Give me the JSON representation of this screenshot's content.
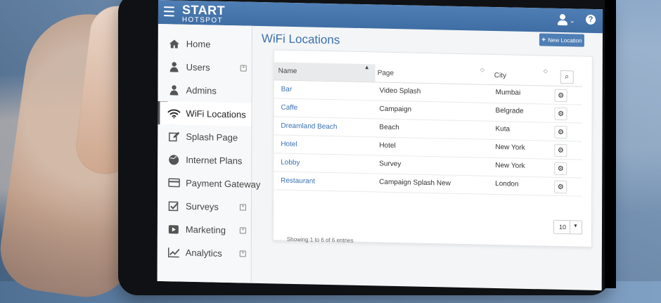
{
  "app": {
    "brand_top": "START",
    "brand_bottom": "HOTSPOT",
    "help": "?",
    "user_caret": "⌄"
  },
  "sidebar": {
    "items": [
      {
        "label": "Home",
        "icon": "home-icon"
      },
      {
        "label": "Users",
        "icon": "user-icon",
        "expandable": true
      },
      {
        "label": "Admins",
        "icon": "user-icon"
      },
      {
        "label": "WiFi Locations",
        "icon": "wifi-icon",
        "active": true
      },
      {
        "label": "Splash Page",
        "icon": "edit-icon"
      },
      {
        "label": "Internet Plans",
        "icon": "globe-icon"
      },
      {
        "label": "Payment Gateway",
        "icon": "credit-card-icon"
      },
      {
        "label": "Surveys",
        "icon": "check-square-icon",
        "expandable": true
      },
      {
        "label": "Marketing",
        "icon": "play-icon",
        "expandable": true
      },
      {
        "label": "Analytics",
        "icon": "chart-icon",
        "expandable": true
      }
    ]
  },
  "main": {
    "title": "WiFi Locations",
    "new_location_label": "New Location",
    "table": {
      "columns": [
        "Name",
        "Page",
        "City"
      ],
      "rows": [
        {
          "name": "Bar",
          "page": "Video Splash",
          "city": "Mumbai"
        },
        {
          "name": "Caffe",
          "page": "Campaign",
          "city": "Belgrade"
        },
        {
          "name": "Dreamland Beach",
          "page": "Beach",
          "city": "Kuta"
        },
        {
          "name": "Hotel",
          "page": "Hotel",
          "city": "New York"
        },
        {
          "name": "Lobby",
          "page": "Survey",
          "city": "New York"
        },
        {
          "name": "Restaurant",
          "page": "Campaign Splash New",
          "city": "London"
        }
      ],
      "page_size": "10",
      "entries": "Showing 1 to 6 of 6 entries"
    }
  }
}
